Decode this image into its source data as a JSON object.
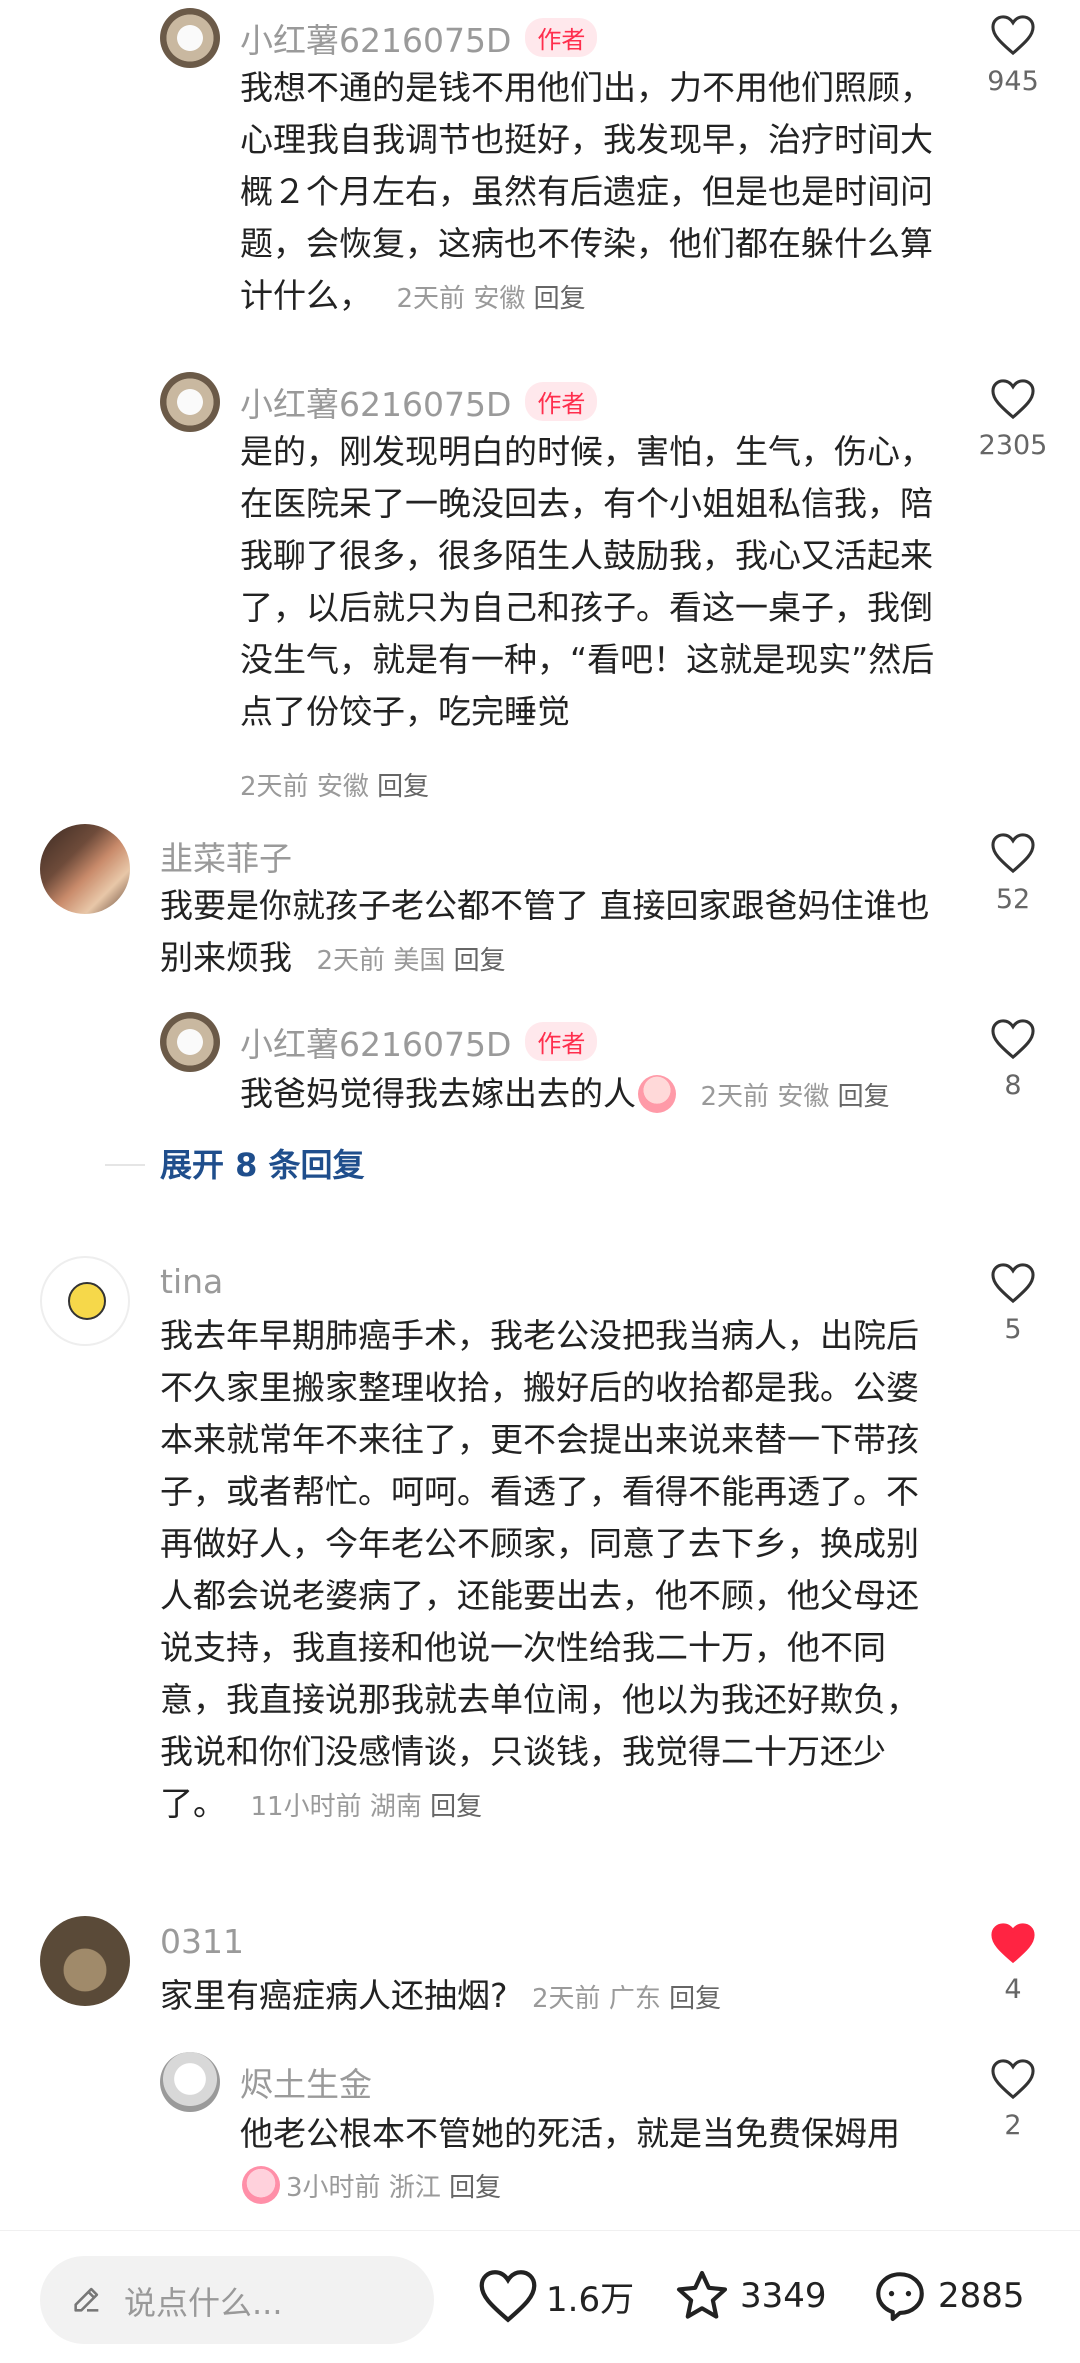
{
  "comments": [
    {
      "author": "小红薯6216075D",
      "badge": "作者",
      "text": "我想不通的是钱不用他们出，力不用他们照顾，心理我自我调节也挺好，我发现早，治疗时间大概２个月左右，虽然有后遗症，但是也是时间问题，会恢复，这病也不传染，他们都在躲什么算计什么，",
      "time": "2天前",
      "location": "安徽",
      "reply": "回复",
      "likes": "945"
    },
    {
      "author": "小红薯6216075D",
      "badge": "作者",
      "text": "是的，刚发现明白的时候，害怕，生气，伤心，在医院呆了一晚没回去，有个小姐姐私信我，陪我聊了很多，很多陌生人鼓励我，我心又活起来了，以后就只为自己和孩子。看这一桌子，我倒没生气，就是有一种，“看吧！这就是现实”然后点了份饺子，吃完睡觉",
      "time": "2天前",
      "location": "安徽",
      "reply": "回复",
      "likes": "2305"
    },
    {
      "author": "韭菜菲子",
      "text": "我要是你就孩子老公都不管了 直接回家跟爸妈住谁也别来烦我",
      "time": "2天前",
      "location": "美国",
      "reply": "回复",
      "likes": "52"
    },
    {
      "author": "小红薯6216075D",
      "badge": "作者",
      "text": "我爸妈觉得我去嫁出去的人",
      "emoji": "crying-emoji",
      "time": "2天前",
      "location": "安徽",
      "reply": "回复",
      "likes": "8"
    },
    {
      "author": "tina",
      "text": "我去年早期肺癌手术，我老公没把我当病人，出院后不久家里搬家整理收拾，搬好后的收拾都是我。公婆本来就常年不来往了，更不会提出来说来替一下带孩子，或者帮忙。呵呵。看透了，看得不能再透了。不再做好人，今年老公不顾家，同意了去下乡，换成别人都会说老婆病了，还能要出去，他不顾，他父母还说支持，我直接和他说一次性给我二十万，他不同意，我直接说那我就去单位闹，他以为我还好欺负，我说和你们没感情谈，只谈钱，我觉得二十万还少了。",
      "time": "11小时前",
      "location": "湖南",
      "reply": "回复",
      "likes": "5"
    },
    {
      "author": "0311",
      "text": "家里有癌症病人还抽烟?",
      "time": "2天前",
      "location": "广东",
      "reply": "回复",
      "likes": "4",
      "liked": true
    },
    {
      "author": "烬土生金",
      "text": "他老公根本不管她的死活，就是当免费保姆用",
      "emoji": "pig-emoji",
      "time": "3小时前",
      "location": "浙江",
      "reply": "回复",
      "likes": "2"
    }
  ],
  "expand_replies": "展开 8 条回复",
  "bottom_bar": {
    "input_placeholder": "说点什么...",
    "likes": "1.6万",
    "favorites": "3349",
    "comments": "2885"
  },
  "colors": {
    "liked": "#ff2442",
    "badge": "#ff2e4d",
    "link": "#1f4e8c"
  }
}
